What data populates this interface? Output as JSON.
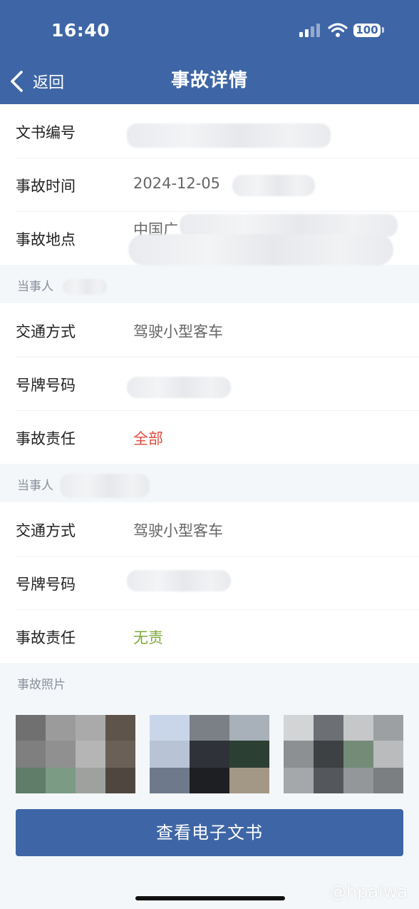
{
  "status_bar": {
    "time": "16:40",
    "battery": "100"
  },
  "nav": {
    "back_label": "返回",
    "title": "事故详情"
  },
  "document": {
    "doc_number_label": "文书编号",
    "time_label": "事故时间",
    "time_value": "2024-12-05",
    "location_label": "事故地点",
    "location_value": "中国广"
  },
  "parties": [
    {
      "header": "当事人",
      "traffic_mode_label": "交通方式",
      "traffic_mode_value": "驾驶小型客车",
      "plate_label": "号牌号码",
      "responsibility_label": "事故责任",
      "responsibility_value": "全部",
      "responsibility_color": "#e04a3c"
    },
    {
      "header": "当事人",
      "traffic_mode_label": "交通方式",
      "traffic_mode_value": "驾驶小型客车",
      "plate_label": "号牌号码",
      "responsibility_label": "事故责任",
      "responsibility_value": "无责",
      "responsibility_color": "#7ea83b"
    }
  ],
  "photos": {
    "label": "事故照片"
  },
  "cta": {
    "label": "查看电子文书"
  },
  "watermark": "@hpaiwa",
  "colors": {
    "header_bg": "#3e66a6",
    "accent": "#3e66a6"
  }
}
